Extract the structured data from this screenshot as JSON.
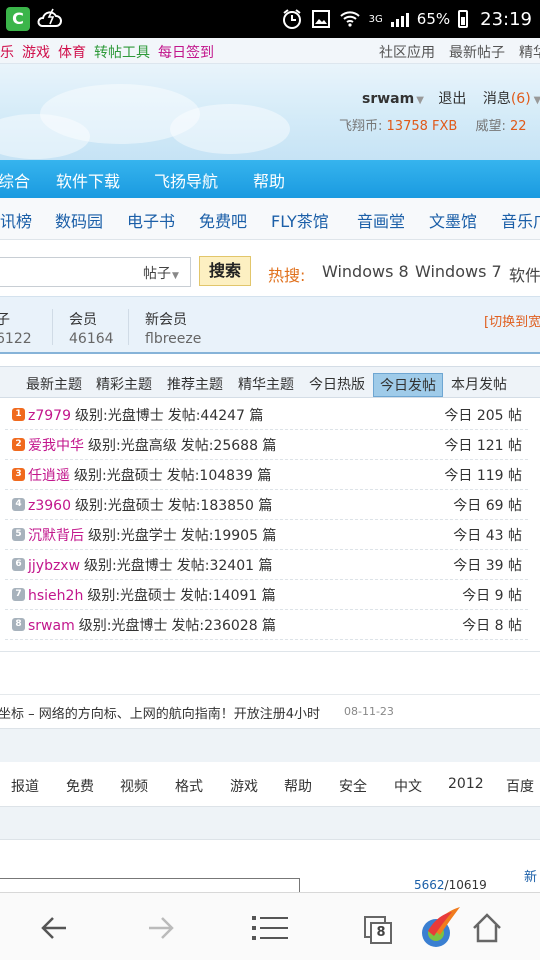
{
  "status_bar": {
    "app_icon_letter": "C",
    "network": "3G",
    "battery": "65%",
    "time": "23:19"
  },
  "top_links": {
    "left": [
      {
        "label": "乐",
        "color": "#d0104c"
      },
      {
        "label": "游戏",
        "color": "#d0104c"
      },
      {
        "label": "体育",
        "color": "#d0104c"
      },
      {
        "label": "转帖工具",
        "color": "#2e9a3a"
      },
      {
        "label": "每日签到",
        "color": "#c2168c"
      }
    ],
    "right": [
      "社区应用",
      "最新帖子",
      "精华"
    ]
  },
  "header": {
    "username": "srwam",
    "logout": "退出",
    "messages_label": "消息",
    "messages_count": "(6)",
    "credit_label": "飞翔币:",
    "credit_value": "13758 FXB",
    "prestige_label": "威望:",
    "prestige_value": "22"
  },
  "main_nav": [
    "综合",
    "软件下载",
    "飞扬导航",
    "帮助"
  ],
  "sub_nav": [
    "资讯榜",
    "数码园",
    "电子书",
    "免费吧",
    "FLY茶馆",
    "音画堂",
    "文墨馆",
    "音乐广"
  ],
  "search": {
    "select": "帖子",
    "button": "搜索",
    "hot_label": "热搜:",
    "hot_words": [
      "Windows 8",
      "Windows 7",
      "软件"
    ]
  },
  "stats": {
    "col1": {
      "label": "子",
      "value": "6122"
    },
    "col2": {
      "label": "会员",
      "value": "46164"
    },
    "col3": {
      "label": "新会员",
      "value": "flbreeze"
    },
    "switch": "[切换到宽"
  },
  "tabs": {
    "items": [
      "最新主题",
      "精彩主题",
      "推荐主题",
      "精华主题",
      "今日热版",
      "今日发帖",
      "本月发帖"
    ],
    "active": "今日发帖"
  },
  "ranking": [
    {
      "rank": "1",
      "name": "z7979",
      "level": "级别:光盘博士",
      "posts": "发帖:44247 篇",
      "today": "今日 205 帖"
    },
    {
      "rank": "2",
      "name": "爱我中华",
      "level": "级别:光盘高级",
      "posts": "发帖:25688 篇",
      "today": "今日 121 帖"
    },
    {
      "rank": "3",
      "name": "任逍遥",
      "level": "级别:光盘硕士",
      "posts": "发帖:104839 篇",
      "today": "今日 119 帖"
    },
    {
      "rank": "4",
      "name": "z3960",
      "level": "级别:光盘硕士",
      "posts": "发帖:183850 篇",
      "today": "今日 69 帖"
    },
    {
      "rank": "5",
      "name": "沉默背后",
      "level": "级别:光盘学士",
      "posts": "发帖:19905 篇",
      "today": "今日 43 帖"
    },
    {
      "rank": "6",
      "name": "jjybzxw",
      "level": "级别:光盘博士",
      "posts": "发帖:32401 篇",
      "today": "今日 39 帖"
    },
    {
      "rank": "7",
      "name": "hsieh2h",
      "level": "级别:光盘硕士",
      "posts": "发帖:14091 篇",
      "today": "今日 9 帖"
    },
    {
      "rank": "8",
      "name": "srwam",
      "level": "级别:光盘博士",
      "posts": "发帖:236028 篇",
      "today": "今日 8 帖"
    }
  ],
  "notice": {
    "text": "坐标 – 网络的方向标、上网的航向指南！开放注册4小时",
    "date": "08-11-23"
  },
  "tag_links": [
    "报道",
    "免费",
    "视频",
    "格式",
    "游戏",
    "帮助",
    "安全",
    "中文",
    "2012",
    "百度"
  ],
  "partial": {
    "count": "5662",
    "total": "/10619",
    "new_link": "新"
  },
  "bottom_bar": {
    "tabs_count": "8"
  },
  "colors": {
    "nav_blue": "#1a9ae0",
    "username_magenta": "#c2168c",
    "accent_orange": "#e05a1a"
  }
}
